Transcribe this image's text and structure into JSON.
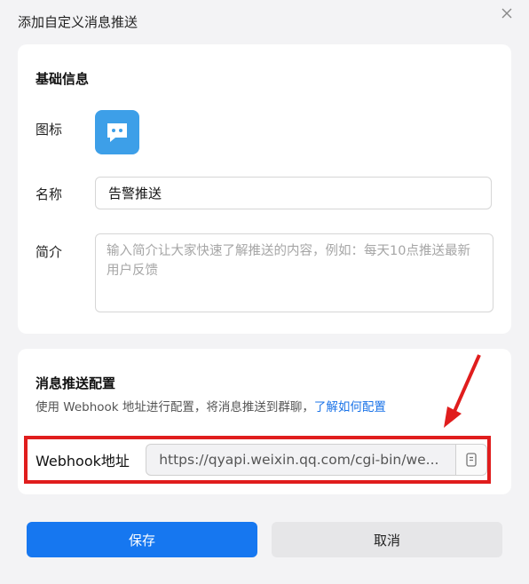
{
  "dialog": {
    "title": "添加自定义消息推送"
  },
  "basic": {
    "section_title": "基础信息",
    "icon_label": "图标",
    "name_label": "名称",
    "name_value": "告警推送",
    "intro_label": "简介",
    "intro_placeholder": "输入简介让大家快速了解推送的内容，例如：每天10点推送最新用户反馈"
  },
  "push": {
    "section_title": "消息推送配置",
    "description": "使用 Webhook 地址进行配置，将消息推送到群聊，",
    "help_link": "了解如何配置",
    "webhook_label": "Webhook地址",
    "webhook_value": "https://qyapi.weixin.qq.com/cgi-bin/we..."
  },
  "buttons": {
    "save": "保存",
    "cancel": "取消"
  },
  "colors": {
    "primary": "#1677f0",
    "icon_bg": "#3d9fe8",
    "highlight": "#e01d1d",
    "link": "#1a73e8"
  }
}
